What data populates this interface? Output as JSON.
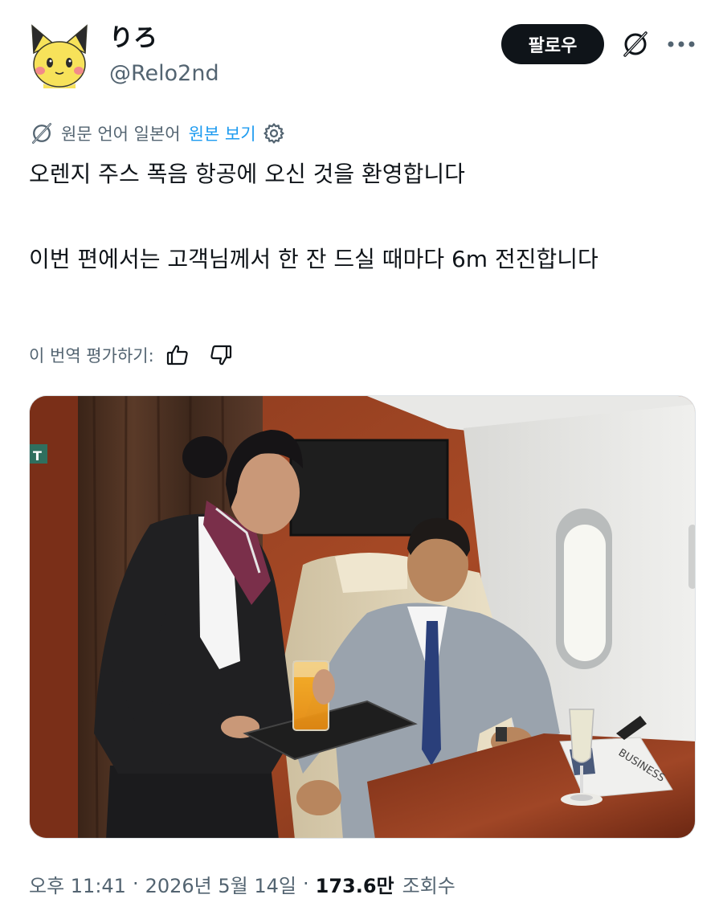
{
  "author": {
    "display_name": "りろ",
    "handle": "@Relo2nd"
  },
  "actions": {
    "follow_label": "팔로우",
    "grok_icon": "grok-icon",
    "more_icon": "more-dots-icon"
  },
  "translation": {
    "label": "원문 언어 일본어",
    "show_original": "원본 보기",
    "settings_icon": "gear-icon"
  },
  "tweet": {
    "line1": "오렌지 주스 폭음 항공에 오신 것을 환영합니다",
    "line2": "이번 편에서는 고객님께서 한 잔 드실 때마다 6m 전진합니다"
  },
  "rating": {
    "label": "이 번역 평가하기:",
    "like_icon": "thumbs-up-icon",
    "dislike_icon": "thumbs-down-icon"
  },
  "media": {
    "newspaper_text": "BUSINESS",
    "exit_sign_text": "T"
  },
  "meta": {
    "time": "오후 11:41",
    "date": "2026년 5월 14일",
    "views_count": "173.6만",
    "views_label": "조회수"
  },
  "colors": {
    "text_primary": "#0f1419",
    "text_secondary": "#536471",
    "link": "#1d9bf0",
    "follow_bg": "#0f1419"
  }
}
